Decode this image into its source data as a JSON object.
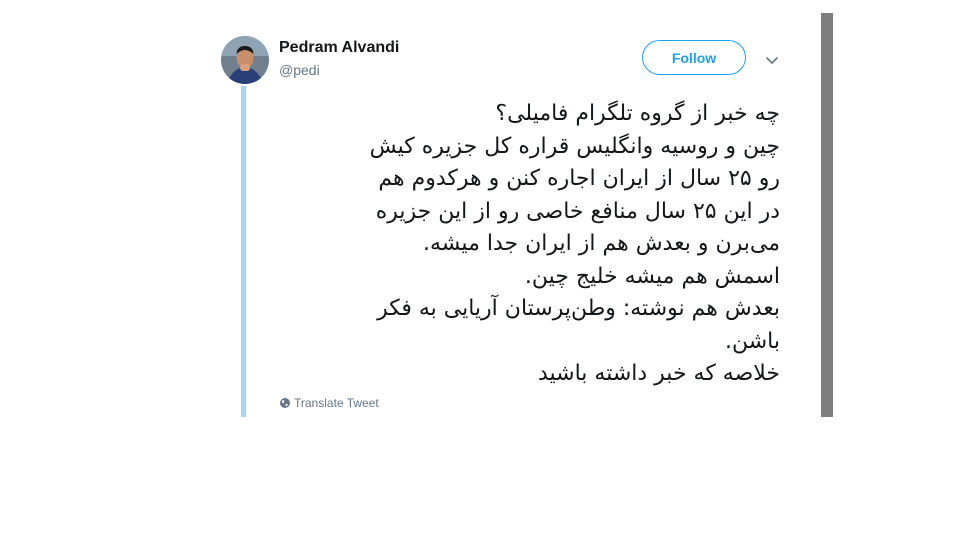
{
  "tweet": {
    "author": {
      "display_name": "Pedram Alvandi",
      "handle": "@pedi",
      "avatar_icon": "profile-photo"
    },
    "follow_label": "Follow",
    "menu_icon": "chevron-down-icon",
    "text_lines": [
      "چه خبر از گروه تلگرام فامیلی؟",
      "چین و روسیه وانگلیس قراره کل جزیره کیش",
      "رو ۲۵ سال از ایران اجاره کنن و هرکدوم هم",
      "در این ۲۵ سال منافع خاصی رو از این جزیره",
      "می‌برن و بعدش هم از ایران جدا میشه.",
      "اسمش هم میشه خلیج چین.",
      "بعدش هم نوشته: وطن‌پرستان آریایی به فکر",
      "باشن.",
      "خلاصه که خبر داشته باشید"
    ],
    "translate_label": "Translate Tweet"
  },
  "colors": {
    "accent": "#1da1f2",
    "thread_line": "#a8d4f8",
    "secondary_text": "#657786",
    "scrollbar": "#7f7f7f"
  }
}
